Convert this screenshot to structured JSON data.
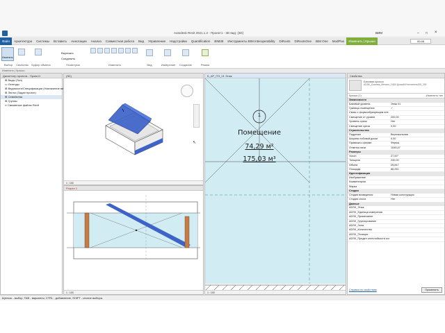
{
  "window": {
    "title": "Autodesk Revit 2021.1.2 - Проект1 - 3D вид: {3D}",
    "user": "ВИМ",
    "clock": "00:46"
  },
  "ribbon": {
    "tabs": [
      "Файл",
      "Архитектура",
      "Системы",
      "Вставить",
      "Аннотации",
      "Анализ",
      "Совместная работа",
      "Вид",
      "Управление",
      "Надстройки",
      "Quantification",
      "BIM38",
      "Инструменты BIM Interoperability",
      "DiRoots",
      "DiRootsOne",
      "BIM One",
      "ModPlus",
      "Изменить | Крыши"
    ],
    "panels": [
      "Выбор",
      "Свойства",
      "Буфер обмена",
      "Геометрия",
      "Изменить",
      "Вид",
      "Измерение",
      "Создание",
      "Режим"
    ],
    "modify_label": "Изменить",
    "tools": [
      "Вырезать",
      "Соединить"
    ]
  },
  "options_bar": "Изменить | Крыши",
  "project_browser": {
    "title": "Диспетчер проекта - Проект1",
    "items": [
      "Виды (Тип)",
      "Легенды",
      "Ведомости/Спецификации (Назначение вида)",
      "Листы (Задан проект)",
      "Семейства",
      "Группы",
      "Связанные файлы Revit"
    ]
  },
  "views": {
    "view3d": {
      "title": "{3D}",
      "scale": "1 : 100"
    },
    "section": {
      "title": "Разрез 1",
      "scale": "1 : 100"
    },
    "plan": {
      "title": "Б_АР_ПЭ_01 Этаж",
      "scale": "1 : 100"
    }
  },
  "room": {
    "number": "1",
    "name": "Помещение",
    "area": "74,29 м²",
    "volume": "175,03 м³"
  },
  "properties": {
    "title": "Свойства",
    "type_name": "Базовая крыша",
    "type_sub": "ADSK_Скатная_Металл_0.500 Доска6/Утеплитель150_200",
    "edit_type": "Изменить тип",
    "selector": "Крыши (1)",
    "groups": [
      {
        "name": "Зависимости",
        "rows": [
          [
            "Базовый уровень",
            "Этаж 01"
          ],
          [
            "Границы помещения",
            "✓"
          ],
          [
            "Связь с формообразующим эле...",
            ""
          ],
          [
            "Смещение от уровня",
            "200,00"
          ],
          [
            "Уровень среза",
            "Нет"
          ],
          [
            "Смещение среза",
            "0,00"
          ]
        ]
      },
      {
        "name": "Строительство",
        "rows": [
          [
            "Подрезка",
            "Вертикальная"
          ],
          [
            "Ширина лобовой доски",
            "0,00"
          ],
          [
            "Привязка к ферме",
            "Ферма"
          ],
          [
            "Отметка низа",
            "1045,47"
          ]
        ]
      },
      {
        "name": "Размеры",
        "rows": [
          [
            "Уклон",
            "27,00°"
          ],
          [
            "Толщина",
            "240,00"
          ],
          [
            "Объем",
            "25,847"
          ],
          [
            "Площадь",
            "86,251"
          ]
        ]
      },
      {
        "name": "Идентификация",
        "rows": [
          [
            "Изображение",
            ""
          ],
          [
            "Комментарии",
            ""
          ],
          [
            "Марка",
            ""
          ]
        ]
      },
      {
        "name": "Стадии",
        "rows": [
          [
            "Стадия возведения",
            "Новая конструкция"
          ],
          [
            "Стадия сноса",
            "Нет"
          ]
        ]
      },
      {
        "name": "Данные",
        "rows": [
          [
            "ADSK_Этаж",
            ""
          ],
          [
            "ADSK_Единица измерения",
            ""
          ],
          [
            "ADSK_Примечание",
            ""
          ],
          [
            "ADSK_Группирование",
            ""
          ],
          [
            "ADSK_Зона",
            ""
          ],
          [
            "ADSK_Количество",
            ""
          ],
          [
            "ADSK_Позиция",
            ""
          ],
          [
            "ADSK_Предел огнестойкости кон...",
            ""
          ]
        ]
      }
    ],
    "help_link": "Справка по свойствам",
    "apply": "Применить"
  },
  "status": "Щелчок - выбор, TAB - варианты, CTRL - добавление, SHIFT - снятие выбора.",
  "colors": {
    "accent": "#1f5fa3",
    "room_fill": "#d2ecf3",
    "roof_blue": "#3d63c9",
    "wall_orange": "#c57b46"
  }
}
